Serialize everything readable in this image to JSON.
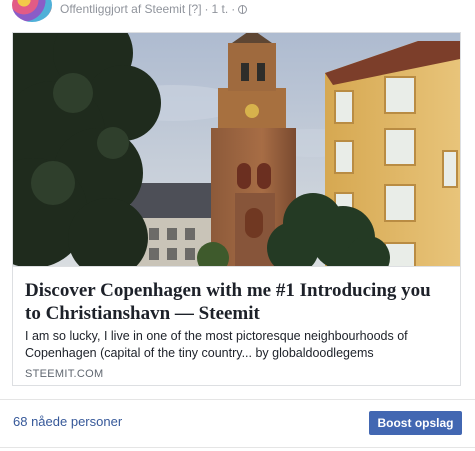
{
  "header": {
    "published_text": "Offentliggjort af Steemit",
    "help_marker": "[?]",
    "separator": "·",
    "time": "1 t.",
    "audience_icon": "globe-icon"
  },
  "card": {
    "image_subject": "photo",
    "title": "Discover Copenhagen with me #1 Introducing you to Christianshavn — Steemit",
    "description": "I am so lucky, I live in one of the most pictoresque neighbourhoods of Copenhagen (capital of the tiny country... by globaldoodlegems",
    "domain": "STEEMIT.COM"
  },
  "footer": {
    "reach_text": "68 nåede personer",
    "boost_label": "Boost opslag"
  },
  "colors": {
    "link": "#365899",
    "button": "#4267b2",
    "border": "#dddfe2",
    "meta_text": "#90949c"
  }
}
